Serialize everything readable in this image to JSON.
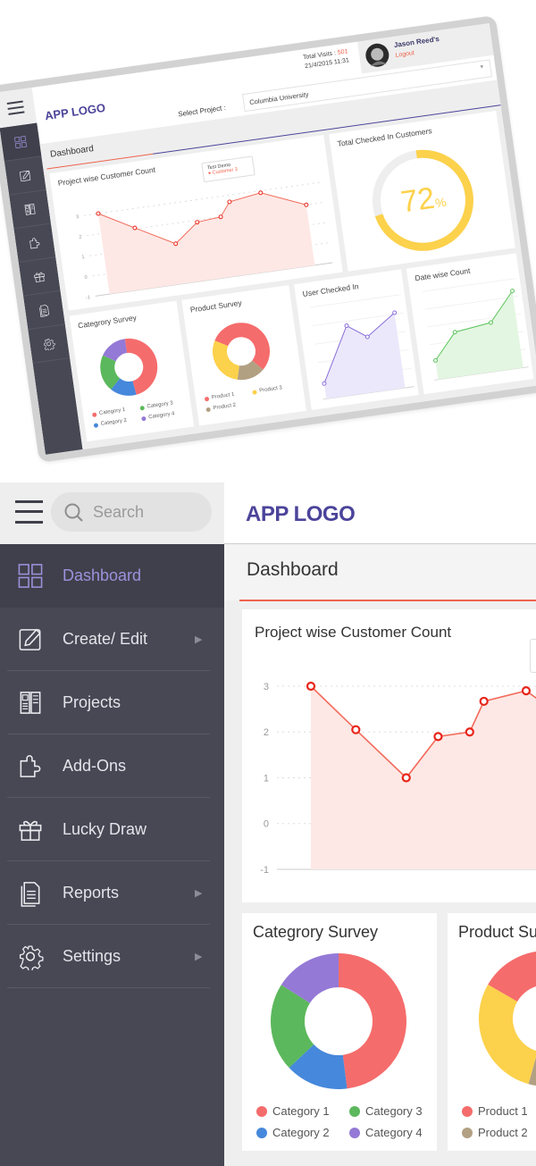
{
  "mockup": {
    "logo": "APP LOGO",
    "total_visits_label": "Total Visits : ",
    "total_visits": "501",
    "datetime": "21/4/2015 11:31",
    "user_name": "Jason Reed's",
    "logout": "Logout",
    "select_label": "Select Project :",
    "select_value": "Columbia University",
    "page_title": "Dashboard",
    "tooltip": {
      "title": "Test Demo",
      "series": "Customer 3"
    },
    "gauge": {
      "title": "Total Checked In Customers",
      "value": 72,
      "unit": "%",
      "color": "#fcd14b"
    }
  },
  "header": {
    "logo": "APP LOGO",
    "search_placeholder": "Search"
  },
  "sidebar": {
    "items": [
      {
        "label": "Dashboard",
        "icon": "dashboard-icon",
        "active": true
      },
      {
        "label": "Create/ Edit",
        "icon": "edit-icon",
        "submenu": true
      },
      {
        "label": "Projects",
        "icon": "projects-icon"
      },
      {
        "label": "Add-Ons",
        "icon": "puzzle-icon"
      },
      {
        "label": "Lucky Draw",
        "icon": "gift-icon"
      },
      {
        "label": "Reports",
        "icon": "reports-icon",
        "submenu": true
      },
      {
        "label": "Settings",
        "icon": "gear-icon",
        "submenu": true
      }
    ]
  },
  "page_title": "Dashboard",
  "colors": {
    "logo": "#4b449a",
    "sidebar": "#474854",
    "active_text": "#9d91dd",
    "accent": "#f0624d"
  },
  "chart_data": [
    {
      "type": "area",
      "title": "Project wise Customer Count",
      "values": [
        3,
        2.05,
        1,
        1.9,
        2,
        2.67,
        2.9,
        2.0
      ],
      "ylim": [
        -1,
        3
      ],
      "yticks": [
        3,
        2,
        1,
        0,
        -1
      ],
      "grid": true,
      "color": "#f26b5b"
    },
    {
      "type": "pie",
      "title": "Categrory Survey",
      "labels": [
        "Category 1",
        "Category 2",
        "Category 3",
        "Category 4"
      ],
      "values": [
        48,
        15,
        21,
        16
      ],
      "colors": [
        "#f56c6c",
        "#4688db",
        "#5cb85c",
        "#9479d6"
      ],
      "legend": "bottom"
    },
    {
      "type": "pie",
      "title": "Product Survey",
      "labels": [
        "Product 1",
        "Product 2",
        "Product 3"
      ],
      "values": [
        55,
        16,
        29
      ],
      "colors": [
        "#f56c6c",
        "#b2a083",
        "#fcd14b"
      ],
      "legend": "bottom"
    },
    {
      "type": "area",
      "title": "User Checked In",
      "values": [
        1,
        4.5,
        3.6,
        4.9
      ],
      "ylim": [
        0,
        6
      ],
      "grid": true,
      "color": "#8a6fd9"
    },
    {
      "type": "area",
      "title": "Date wise Count",
      "values": [
        1.3,
        3,
        3.3,
        5.2
      ],
      "ylim": [
        0,
        6
      ],
      "grid": true,
      "color": "#5cc45c"
    }
  ]
}
